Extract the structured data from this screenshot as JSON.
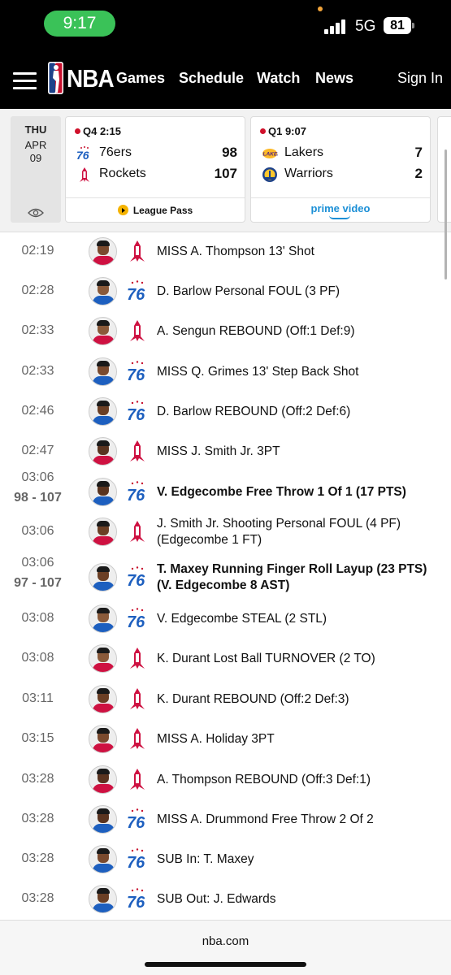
{
  "status_bar": {
    "time": "9:17",
    "network": "5G",
    "battery": "81"
  },
  "nav": {
    "logo": "NBA",
    "links": [
      "Games",
      "Schedule",
      "Watch",
      "News"
    ],
    "sign_in": "Sign In"
  },
  "scoreboard": {
    "date": {
      "dow": "THU",
      "month": "APR",
      "day": "09"
    },
    "games": [
      {
        "clock": "Q4 2:15",
        "teams": [
          {
            "name": "76ers",
            "score": "98"
          },
          {
            "name": "Rockets",
            "score": "107"
          }
        ],
        "broadcast": "League Pass"
      },
      {
        "clock": "Q1 9:07",
        "teams": [
          {
            "name": "Lakers",
            "score": "7"
          },
          {
            "name": "Warriors",
            "score": "2"
          }
        ],
        "broadcast": "prime video"
      }
    ]
  },
  "plays": [
    {
      "time": "02:19",
      "score": "",
      "team": "HOU",
      "desc": "MISS A. Thompson 13' Shot",
      "bold": false
    },
    {
      "time": "02:28",
      "score": "",
      "team": "PHI",
      "desc": "D. Barlow Personal FOUL (3 PF)",
      "bold": false
    },
    {
      "time": "02:33",
      "score": "",
      "team": "HOU",
      "desc": "A. Sengun REBOUND (Off:1 Def:9)",
      "bold": false
    },
    {
      "time": "02:33",
      "score": "",
      "team": "PHI",
      "desc": "MISS Q. Grimes 13' Step Back Shot",
      "bold": false
    },
    {
      "time": "02:46",
      "score": "",
      "team": "PHI",
      "desc": "D. Barlow REBOUND (Off:2 Def:6)",
      "bold": false
    },
    {
      "time": "02:47",
      "score": "",
      "team": "HOU",
      "desc": "MISS J. Smith Jr. 3PT",
      "bold": false
    },
    {
      "time": "03:06",
      "score": "98 - 107",
      "team": "PHI",
      "desc": "V. Edgecombe Free Throw 1 Of 1 (17 PTS)",
      "bold": true
    },
    {
      "time": "03:06",
      "score": "",
      "team": "HOU",
      "desc": "J. Smith Jr. Shooting Personal FOUL (4 PF) (Edgecombe 1 FT)",
      "bold": false
    },
    {
      "time": "03:06",
      "score": "97 - 107",
      "team": "PHI",
      "desc": "T. Maxey Running Finger Roll Layup (23 PTS) (V. Edgecombe 8 AST)",
      "bold": true
    },
    {
      "time": "03:08",
      "score": "",
      "team": "PHI",
      "desc": "V. Edgecombe STEAL (2 STL)",
      "bold": false
    },
    {
      "time": "03:08",
      "score": "",
      "team": "HOU",
      "desc": "K. Durant Lost Ball TURNOVER (2 TO)",
      "bold": false
    },
    {
      "time": "03:11",
      "score": "",
      "team": "HOU",
      "desc": "K. Durant REBOUND (Off:2 Def:3)",
      "bold": false
    },
    {
      "time": "03:15",
      "score": "",
      "team": "HOU",
      "desc": "MISS A. Holiday 3PT",
      "bold": false
    },
    {
      "time": "03:28",
      "score": "",
      "team": "HOU",
      "desc": "A. Thompson REBOUND (Off:3 Def:1)",
      "bold": false
    },
    {
      "time": "03:28",
      "score": "",
      "team": "PHI",
      "desc": "MISS A. Drummond Free Throw 2 Of 2",
      "bold": false
    },
    {
      "time": "03:28",
      "score": "",
      "team": "PHI",
      "desc": "SUB In: T. Maxey",
      "bold": false
    },
    {
      "time": "03:28",
      "score": "",
      "team": "PHI",
      "desc": "SUB Out: J. Edwards",
      "bold": false
    }
  ],
  "browser": {
    "url": "nba.com"
  },
  "colors": {
    "nav_bg": "#000000",
    "live_dot": "#d0112b",
    "sixers_blue": "#1d5fbf",
    "rockets_red": "#ce1141",
    "prime_blue": "#1b8fd6",
    "clock_green": "#3ac258"
  }
}
